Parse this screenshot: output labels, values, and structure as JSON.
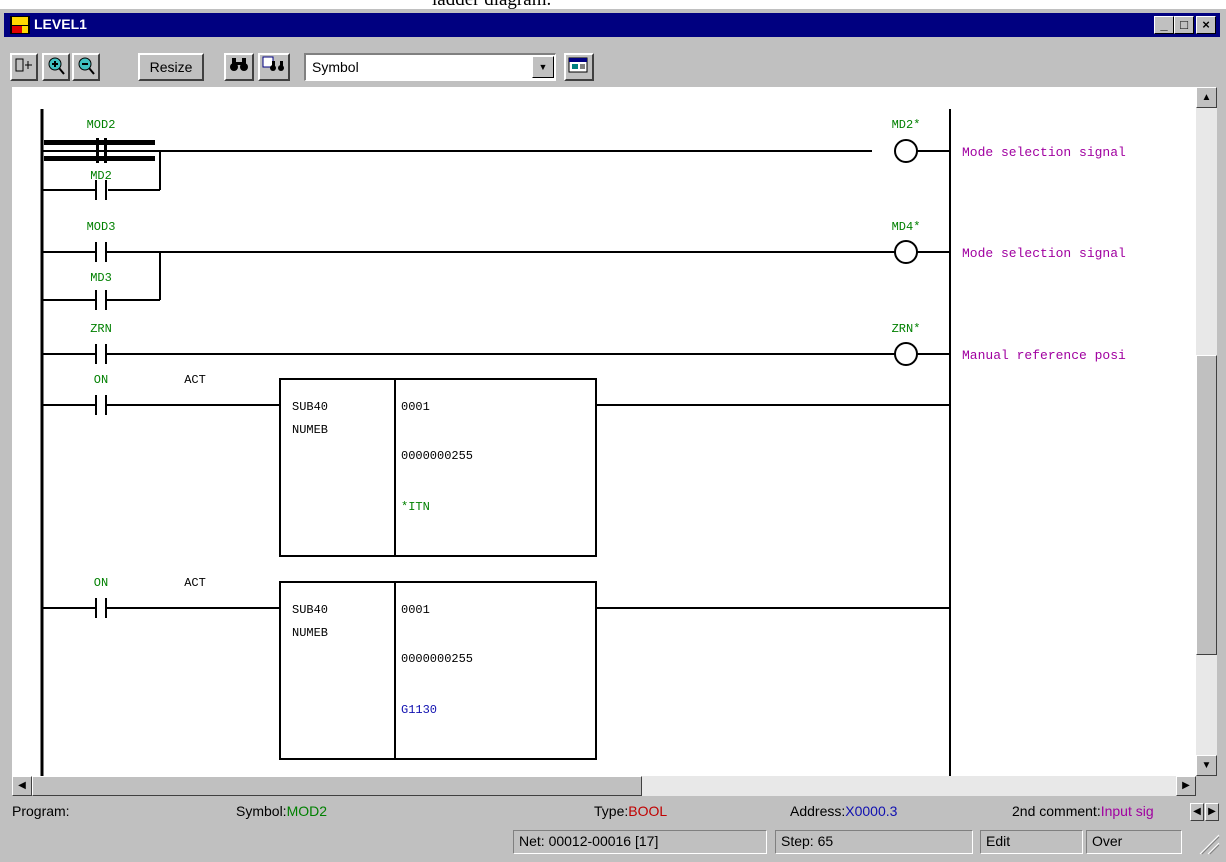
{
  "caption_fragment": "ladder diagram.",
  "window": {
    "title": "LEVEL1",
    "buttons": {
      "minimize": "_",
      "maximize": "□",
      "close": "×"
    }
  },
  "toolbar": {
    "resize_label": "Resize",
    "view_select": "Symbol"
  },
  "ladder": {
    "rungs": [
      {
        "contact": "MOD2",
        "branch_contact": "MD2",
        "coil": "MD2*",
        "comment": "Mode selection signal"
      },
      {
        "contact": "MOD3",
        "branch_contact": "MD3",
        "coil": "MD4*",
        "comment": "Mode selection signal"
      },
      {
        "contact": "ZRN",
        "coil": "ZRN*",
        "comment": "Manual reference posi"
      }
    ],
    "functions": [
      {
        "contact": "ON",
        "input_label": "ACT",
        "name": "SUB40",
        "sub": "NUMEB",
        "p1": "0001",
        "p2": "0000000255",
        "p3": "*ITN"
      },
      {
        "contact": "ON",
        "input_label": "ACT",
        "name": "SUB40",
        "sub": "NUMEB",
        "p1": "0001",
        "p2": "0000000255",
        "p3": "G1130"
      }
    ]
  },
  "status": {
    "program_label": "Program:",
    "symbol_label": "Symbol:",
    "symbol_value": "MOD2",
    "type_label": "Type:",
    "type_value": "BOOL",
    "address_label": "Address:",
    "address_value": "X0000.3",
    "comment_label": "2nd comment:",
    "comment_value": "Input sig",
    "net": "Net: 00012-00016 [17]",
    "step": "Step: 65",
    "mode": "Edit",
    "insert": "Over"
  },
  "colors": {
    "title_bar": "#000080",
    "symbol_text": "#008000",
    "comment_text": "#a000a0",
    "address_text": "#1010b0",
    "type_text": "#c00000"
  }
}
